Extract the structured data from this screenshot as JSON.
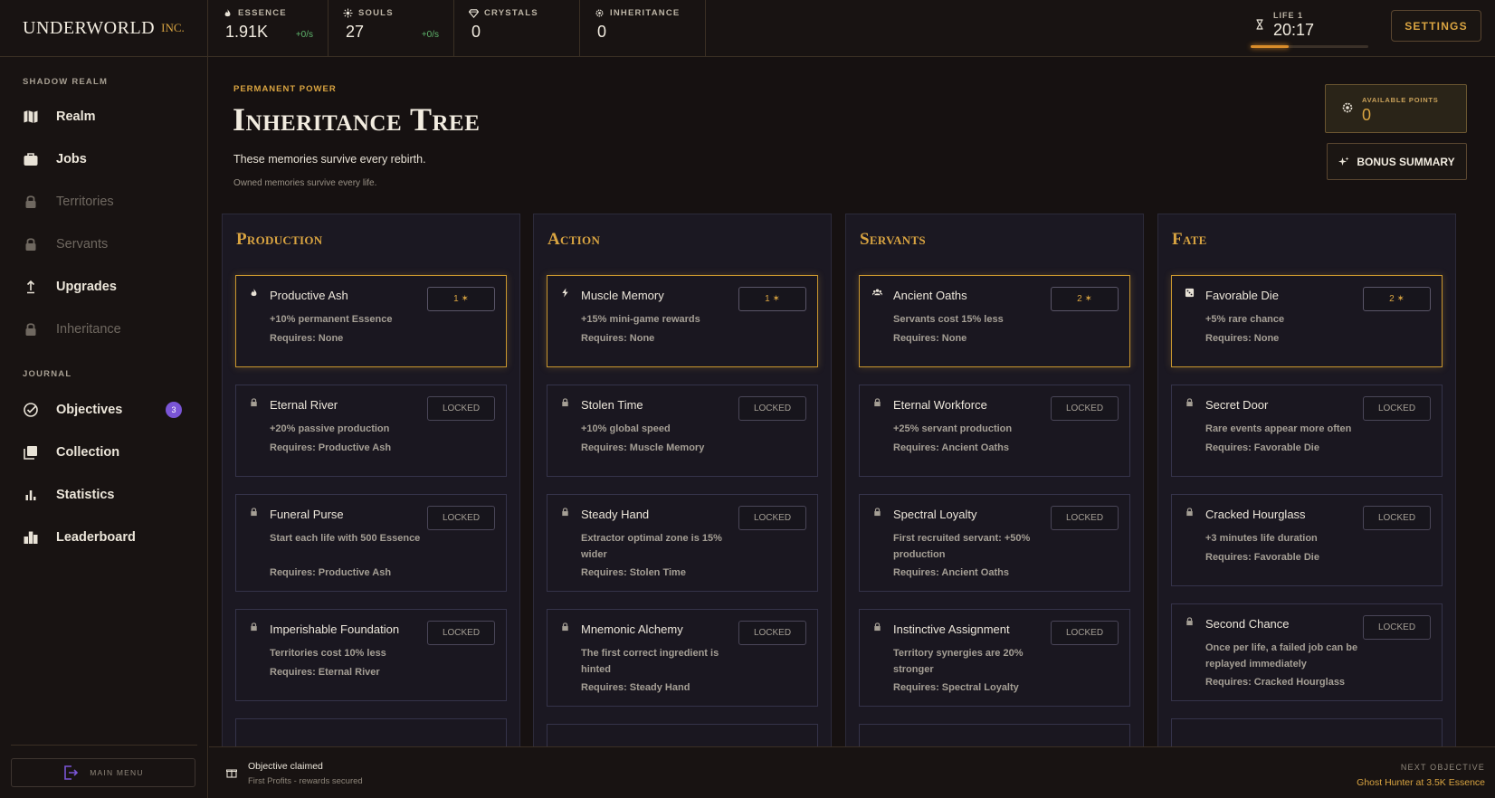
{
  "brand": {
    "name": "UNDERWORLD",
    "suffix": "INC."
  },
  "stats": [
    {
      "label": "ESSENCE",
      "value": "1.91K",
      "rate": "+0/s",
      "icon": "flame-icon"
    },
    {
      "label": "SOULS",
      "value": "27",
      "rate": "+0/s",
      "icon": "sparkle-icon"
    },
    {
      "label": "CRYSTALS",
      "value": "0",
      "icon": "diamond-icon"
    },
    {
      "label": "INHERITANCE",
      "value": "0",
      "icon": "gear-icon"
    }
  ],
  "life": {
    "label": "LIFE 1",
    "time": "20:17",
    "progress": 0.32
  },
  "settings_label": "SETTINGS",
  "sidebar": {
    "section_realm": "SHADOW REALM",
    "section_journal": "JOURNAL",
    "items": [
      {
        "label": "Realm",
        "icon": "map-icon",
        "locked": false
      },
      {
        "label": "Jobs",
        "icon": "briefcase-icon",
        "locked": false
      },
      {
        "label": "Territories",
        "icon": "lock-icon",
        "locked": true
      },
      {
        "label": "Servants",
        "icon": "lock-icon",
        "locked": true
      },
      {
        "label": "Upgrades",
        "icon": "upload-icon",
        "locked": false
      },
      {
        "label": "Inheritance",
        "icon": "lock-icon",
        "locked": true
      }
    ],
    "journal_items": [
      {
        "label": "Objectives",
        "icon": "check-circle-icon",
        "badge": "3"
      },
      {
        "label": "Collection",
        "icon": "collection-icon"
      },
      {
        "label": "Statistics",
        "icon": "bar-chart-icon"
      },
      {
        "label": "Leaderboard",
        "icon": "leaderboard-icon"
      }
    ],
    "main_menu_label": "MAIN MENU"
  },
  "main": {
    "eyebrow": "PERMANENT POWER",
    "title": "Inheritance Tree",
    "subtitle": "These memories survive every rebirth.",
    "note": "Owned memories survive every life.",
    "points_label": "AVAILABLE POINTS",
    "points_value": "0",
    "bonus_label": "BONUS SUMMARY"
  },
  "columns": [
    {
      "title": "Production",
      "nodes": [
        {
          "title": "Productive Ash",
          "desc": "+10% permanent Essence",
          "req": "Requires: None",
          "btn": "1 ✶",
          "owned": true,
          "icon": "flame-icon"
        },
        {
          "title": "Eternal River",
          "desc": "+20% passive production",
          "req": "Requires: Productive Ash",
          "btn": "LOCKED",
          "owned": false,
          "icon": "lock-icon"
        },
        {
          "title": "Funeral Purse",
          "desc": "Start each life with 500 Essence",
          "req": "Requires: Productive Ash",
          "btn": "LOCKED",
          "owned": false,
          "icon": "lock-icon"
        },
        {
          "title": "Imperishable Foundation",
          "desc": "Territories cost 10% less",
          "req": "Requires: Eternal River",
          "btn": "LOCKED",
          "owned": false,
          "icon": "lock-icon"
        }
      ]
    },
    {
      "title": "Action",
      "nodes": [
        {
          "title": "Muscle Memory",
          "desc": "+15% mini-game rewards",
          "req": "Requires: None",
          "btn": "1 ✶",
          "owned": true,
          "icon": "bolt-icon"
        },
        {
          "title": "Stolen Time",
          "desc": "+10% global speed",
          "req": "Requires: Muscle Memory",
          "btn": "LOCKED",
          "owned": false,
          "icon": "lock-icon"
        },
        {
          "title": "Steady Hand",
          "desc": "Extractor optimal zone is 15% wider",
          "req": "Requires: Stolen Time",
          "btn": "LOCKED",
          "owned": false,
          "icon": "lock-icon"
        },
        {
          "title": "Mnemonic Alchemy",
          "desc": "The first correct ingredient is hinted",
          "req": "Requires: Steady Hand",
          "btn": "LOCKED",
          "owned": false,
          "icon": "lock-icon"
        }
      ]
    },
    {
      "title": "Servants",
      "nodes": [
        {
          "title": "Ancient Oaths",
          "desc": "Servants cost 15% less",
          "req": "Requires: None",
          "btn": "2 ✶",
          "owned": true,
          "icon": "group-icon"
        },
        {
          "title": "Eternal Workforce",
          "desc": "+25% servant production",
          "req": "Requires: Ancient Oaths",
          "btn": "LOCKED",
          "owned": false,
          "icon": "lock-icon"
        },
        {
          "title": "Spectral Loyalty",
          "desc": "First recruited servant: +50% production",
          "req": "Requires: Ancient Oaths",
          "btn": "LOCKED",
          "owned": false,
          "icon": "lock-icon"
        },
        {
          "title": "Instinctive Assignment",
          "desc": "Territory synergies are 20% stronger",
          "req": "Requires: Spectral Loyalty",
          "btn": "LOCKED",
          "owned": false,
          "icon": "lock-icon"
        }
      ]
    },
    {
      "title": "Fate",
      "nodes": [
        {
          "title": "Favorable Die",
          "desc": "+5% rare chance",
          "req": "Requires: None",
          "btn": "2 ✶",
          "owned": true,
          "icon": "die-icon"
        },
        {
          "title": "Secret Door",
          "desc": "Rare events appear more often",
          "req": "Requires: Favorable Die",
          "btn": "LOCKED",
          "owned": false,
          "icon": "lock-icon"
        },
        {
          "title": "Cracked Hourglass",
          "desc": "+3 minutes life duration",
          "req": "Requires: Favorable Die",
          "btn": "LOCKED",
          "owned": false,
          "icon": "lock-icon"
        },
        {
          "title": "Second Chance",
          "desc": "Once per life, a failed job can be replayed immediately",
          "req": "Requires: Cracked Hourglass",
          "btn": "LOCKED",
          "owned": false,
          "icon": "lock-icon"
        }
      ]
    }
  ],
  "footer": {
    "title": "Objective claimed",
    "sub": "First Profits - rewards secured",
    "next_label": "NEXT OBJECTIVE",
    "next_value": "Ghost Hunter at 3.5K Essence"
  },
  "colors": {
    "accent": "#d9a441",
    "positive": "#5fb56c",
    "badge": "#7a55d6"
  }
}
